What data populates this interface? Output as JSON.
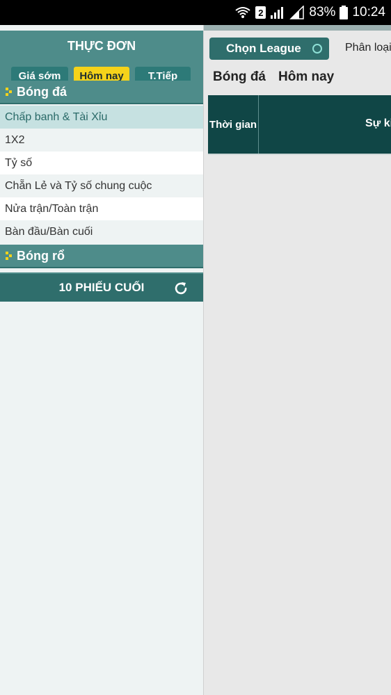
{
  "status": {
    "battery": "83%",
    "time": "10:24",
    "sim": "2"
  },
  "menu": {
    "title": "THỰC ĐƠN",
    "tabs": [
      {
        "label": "Giá sớm"
      },
      {
        "label": "Hôm nay"
      },
      {
        "label": "T.Tiếp"
      }
    ],
    "soccer": {
      "label": "Bóng đá",
      "items": [
        "Chấp banh & Tài Xỉu",
        "1X2",
        "Tỷ số",
        "Chẵn Lẻ và Tỷ số chung cuộc",
        "Nửa trận/Toàn trận",
        "Bàn đầu/Bàn cuối"
      ]
    },
    "basketball": {
      "label": "Bóng rổ"
    },
    "last_bets": "10 PHIẾU CUỐI"
  },
  "main": {
    "league_button": "Chọn League",
    "sort_label": "Phân loại",
    "sport": "Bóng đá",
    "day": "Hôm nay",
    "table": {
      "col_time": "Thời gian",
      "col_event": "Sự kiện"
    }
  },
  "colors": {
    "teal_dark": "#104646",
    "teal": "#2f6e6c",
    "teal_light": "#4e8c8a",
    "accent": "#f5d31a"
  }
}
